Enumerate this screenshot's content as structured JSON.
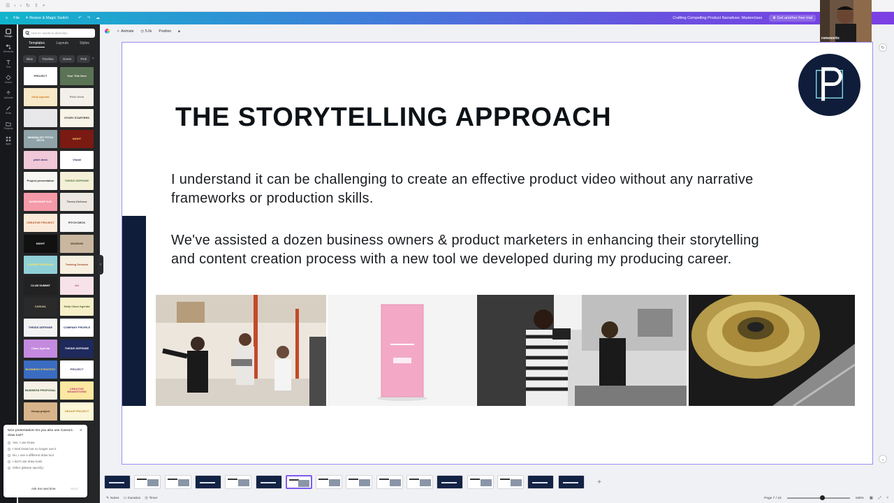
{
  "browser": {
    "tab_icons": [
      "menu-icon",
      "back-icon",
      "forward-icon"
    ]
  },
  "canva_bar": {
    "file_label": "File",
    "resize_label": "Resize & Magic Switch",
    "doc_title": "Crafting Compelling Product Narratives: Masterclass",
    "trial_label": "Get another free trial"
  },
  "rail": {
    "items": [
      {
        "label": "Design",
        "icon": "design-icon"
      },
      {
        "label": "Elements",
        "icon": "elements-icon"
      },
      {
        "label": "Text",
        "icon": "text-icon"
      },
      {
        "label": "Brand",
        "icon": "brand-icon"
      },
      {
        "label": "Uploads",
        "icon": "uploads-icon"
      },
      {
        "label": "Draw",
        "icon": "draw-icon"
      },
      {
        "label": "Projects",
        "icon": "projects-icon"
      },
      {
        "label": "Apps",
        "icon": "apps-icon"
      }
    ]
  },
  "panel": {
    "search_placeholder": "Use 5+ words to describe...",
    "tabs": [
      "Templates",
      "Layouts",
      "Styles"
    ],
    "chips": [
      "Blue",
      "Timeline",
      "Green",
      "Pink"
    ],
    "templates": [
      {
        "text": "PROJECT",
        "bg": "#ffffff",
        "fg": "#333333"
      },
      {
        "text": "Your Title Here",
        "bg": "#5b7355",
        "fg": "#f3efe0"
      },
      {
        "text": "Daily Agenda",
        "bg": "#f7e9c8",
        "fg": "#d6802c"
      },
      {
        "text": "Pitch Deck",
        "bg": "#f3efe9",
        "fg": "#777777"
      },
      {
        "text": "",
        "bg": "#e8e8ea",
        "fg": "#555555"
      },
      {
        "text": "STORY STARTERS",
        "bg": "#f7f3e6",
        "fg": "#333333"
      },
      {
        "text": "MINIMALIST PITCH DECK",
        "bg": "#8fa3a8",
        "fg": "#ffffff"
      },
      {
        "text": "NIGHT",
        "bg": "#7a1a12",
        "fg": "#ffcc66"
      },
      {
        "text": "pitch deck",
        "bg": "#f1c8d8",
        "fg": "#2b2b6a"
      },
      {
        "text": "Visual",
        "bg": "#ffffff",
        "fg": "#223355"
      },
      {
        "text": "Project presentation",
        "bg": "#f7f6f2",
        "fg": "#333333"
      },
      {
        "text": "THESIS DEFENSE",
        "bg": "#f4f0d8",
        "fg": "#557744"
      },
      {
        "text": "WORKSHOP DAY",
        "bg": "#f49aa8",
        "fg": "#ffffff"
      },
      {
        "text": "Thesis Defense",
        "bg": "#ece7e0",
        "fg": "#555555"
      },
      {
        "text": "CREATIVE PROJECT",
        "bg": "#fbe9d8",
        "fg": "#b0562a"
      },
      {
        "text": "PITCH DECK",
        "bg": "#f6f6f6",
        "fg": "#333333"
      },
      {
        "text": "NIGHT",
        "bg": "#111111",
        "fg": "#ffffff"
      },
      {
        "text": "MUSEUM",
        "bg": "#c9b7a0",
        "fg": "#4a3a2a"
      },
      {
        "text": "CAREER WEBINAR",
        "bg": "#8fd0d6",
        "fg": "#f9e36a"
      },
      {
        "text": "Training Seminar",
        "bg": "#f7efe0",
        "fg": "#a0522d"
      },
      {
        "text": "CLUB SUMMIT",
        "bg": "#222222",
        "fg": "#ffffff"
      },
      {
        "text": "Art",
        "bg": "#f7e2ea",
        "fg": "#b05a7a"
      },
      {
        "text": "CASUAL",
        "bg": "#2a2a2a",
        "fg": "#e8d8b0"
      },
      {
        "text": "Daily Class Agenda",
        "bg": "#f6efc8",
        "fg": "#556633"
      },
      {
        "text": "THESIS DEFENSE",
        "bg": "#f3f3f3",
        "fg": "#223366"
      },
      {
        "text": "COMPANY PROFILE",
        "bg": "#ffffff",
        "fg": "#223366"
      },
      {
        "text": "Class Agenda",
        "bg": "#c48ae0",
        "fg": "#ffffff"
      },
      {
        "text": "THESIS DEFENSE",
        "bg": "#1e2a5c",
        "fg": "#ffffff"
      },
      {
        "text": "BUSINESS STRATEGY",
        "bg": "#3a6cc2",
        "fg": "#ffd24a"
      },
      {
        "text": "PROJECT",
        "bg": "#ffffff",
        "fg": "#333366"
      },
      {
        "text": "BUSINESS PROPOSAL",
        "bg": "#f6f1e6",
        "fg": "#2a4a2a"
      },
      {
        "text": "CREATIVE BRAINSTORM",
        "bg": "#fce8a0",
        "fg": "#c0407a"
      },
      {
        "text": "Group project",
        "bg": "#d8b48a",
        "fg": "#3a2a1a"
      },
      {
        "text": "GROUP PROJECT",
        "bg": "#fbf6d8",
        "fg": "#c08a2a"
      }
    ]
  },
  "survey": {
    "question": "Nice presentation! Do you also use Canva's draw tool?",
    "options": [
      "Yes, I use Draw",
      "I tried Draw but no longer use it",
      "No, I use a different draw tool",
      "I don't use draw tools",
      "Other (please specify)"
    ],
    "ask_later": "Ask me next time",
    "send": "Send"
  },
  "editor_toolbar": {
    "animate": "Animate",
    "duration": "5.0s",
    "position": "Position"
  },
  "slide": {
    "title": "THE STORYTELLING APPROACH",
    "para1": "I understand it can be challenging to create an effective product video without any narrative frameworks or production skills.",
    "para2": "We've assisted a dozen business owners & product marketers in enhancing their storytelling and content creation process with a new tool we developed during my producing career.",
    "accent_color": "#0f1d3a"
  },
  "webcam": {
    "name": "romeoortiz"
  },
  "bottom": {
    "notes": "Notes",
    "duration": "Duration",
    "timer": "Timer",
    "page": "Page 7 / 16",
    "zoom": "168%"
  },
  "page_strip": {
    "selected_index": 6,
    "count": 16
  }
}
